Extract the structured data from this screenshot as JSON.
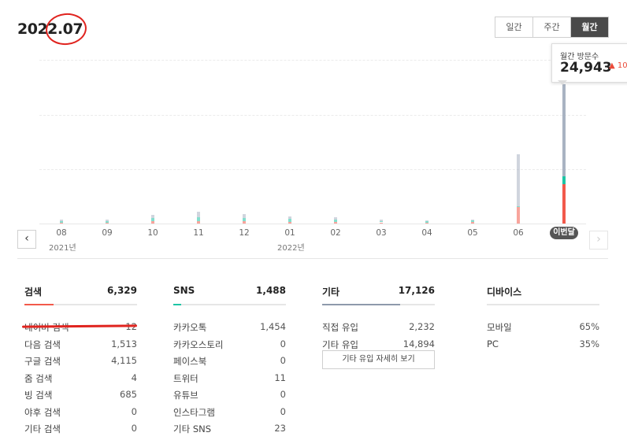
{
  "header": {
    "period": "2022.07",
    "tabs": [
      {
        "label": "일간",
        "active": false
      },
      {
        "label": "주간",
        "active": false
      },
      {
        "label": "월간",
        "active": true
      }
    ]
  },
  "tooltip": {
    "title": "월간 방문수",
    "value": "24,943",
    "change": "10,"
  },
  "chart_data": {
    "type": "bar",
    "categories": [
      "08",
      "09",
      "10",
      "11",
      "12",
      "01",
      "02",
      "03",
      "04",
      "05",
      "06",
      "이번달"
    ],
    "year_labels": [
      {
        "text": "2021년",
        "at": "08"
      },
      {
        "text": "2022년",
        "at": "01"
      }
    ],
    "series": [
      {
        "values": [
          250,
          280,
          600,
          900,
          700,
          520,
          480,
          300,
          150,
          180,
          9500,
          16800
        ],
        "color": "#a9b3c2"
      },
      {
        "values": [
          100,
          80,
          600,
          700,
          600,
          450,
          420,
          250,
          120,
          160,
          200,
          1500
        ],
        "color": "#1ec5a5"
      },
      {
        "values": [
          100,
          80,
          400,
          500,
          400,
          350,
          300,
          200,
          200,
          300,
          3000,
          7200
        ],
        "color": "#f2594b"
      }
    ],
    "current_index": 11,
    "ylim": [
      0,
      30000
    ]
  },
  "stats": {
    "search": {
      "title": "검색",
      "total": "6,329",
      "accent": "#f2594b",
      "accent_ratio": 0.26,
      "rows": [
        {
          "label": "네이버 검색",
          "value": "12"
        },
        {
          "label": "다음 검색",
          "value": "1,513"
        },
        {
          "label": "구글 검색",
          "value": "4,115"
        },
        {
          "label": "줌 검색",
          "value": "4"
        },
        {
          "label": "빙 검색",
          "value": "685"
        },
        {
          "label": "야후 검색",
          "value": "0"
        },
        {
          "label": "기타 검색",
          "value": "0"
        }
      ]
    },
    "sns": {
      "title": "SNS",
      "total": "1,488",
      "accent": "#1ec5a5",
      "accent_ratio": 0.07,
      "rows": [
        {
          "label": "카카오톡",
          "value": "1,454"
        },
        {
          "label": "카카오스토리",
          "value": "0"
        },
        {
          "label": "페이스북",
          "value": "0"
        },
        {
          "label": "트위터",
          "value": "11"
        },
        {
          "label": "유튜브",
          "value": "0"
        },
        {
          "label": "인스타그램",
          "value": "0"
        },
        {
          "label": "기타 SNS",
          "value": "23"
        }
      ]
    },
    "other": {
      "title": "기타",
      "total": "17,126",
      "accent": "#8e9aab",
      "accent_ratio": 0.69,
      "rows": [
        {
          "label": "직접 유입",
          "value": "2,232"
        },
        {
          "label": "기타 유입",
          "value": "14,894"
        }
      ],
      "detail_button": "기타 유입 자세히 보기"
    },
    "device": {
      "title": "디바이스",
      "rows": [
        {
          "label": "모바일",
          "value": "65%"
        },
        {
          "label": "PC",
          "value": "35%"
        }
      ]
    }
  }
}
